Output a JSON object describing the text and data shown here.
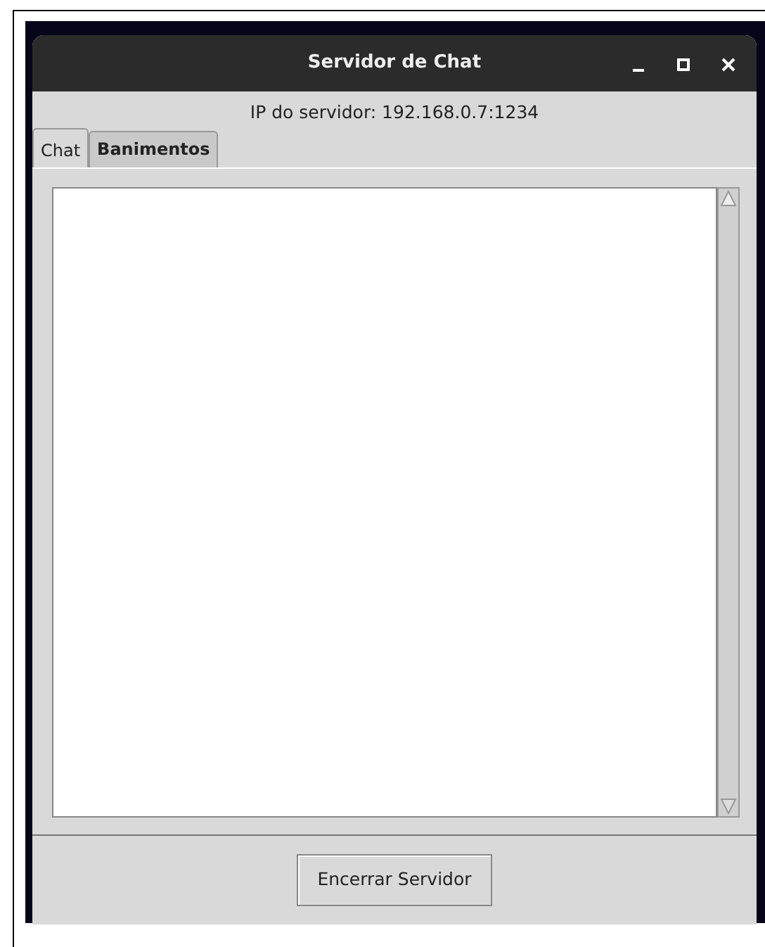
{
  "window": {
    "title": "Servidor de Chat"
  },
  "server_ip": "IP do servidor: 192.168.0.7:1234",
  "tabs": [
    {
      "label": "Chat",
      "selected": true
    },
    {
      "label": "Banimentos",
      "selected": false
    }
  ],
  "buttons": [
    "Encerrar Servidor"
  ]
}
